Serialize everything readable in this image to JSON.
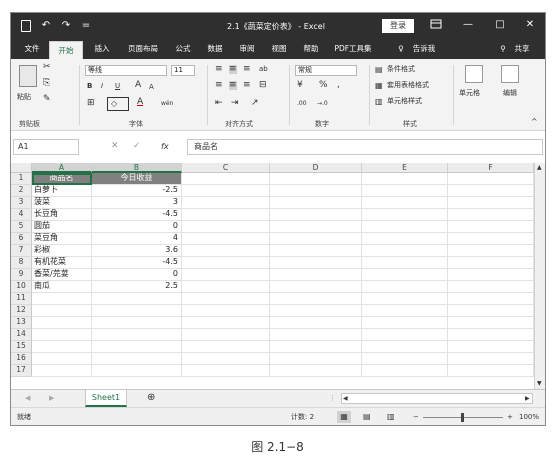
{
  "window": {
    "title": "2.1《蔬菜定价表》 - Excel",
    "login_label": "登录",
    "minimize": "—",
    "restore": "□",
    "close": "✕"
  },
  "qat": {
    "undo": "↶",
    "redo": "↷",
    "more": "="
  },
  "menu": {
    "items": [
      "文件",
      "开始",
      "插入",
      "页面布局",
      "公式",
      "数据",
      "审阅",
      "视图",
      "帮助",
      "PDF工具集"
    ],
    "tellme": "告诉我",
    "share": "共享",
    "active_index": 1
  },
  "ribbon": {
    "paste_label": "粘贴",
    "font_name": "等线",
    "font_size": "11",
    "bold": "B",
    "italic": "I",
    "underline": "U",
    "grow_font": "A",
    "shrink_font": "A",
    "wen": "wén",
    "number_format": "常规",
    "percent": "%",
    "comma": ",",
    "inc_decimal": ".00",
    "dec_decimal": "→.0",
    "cond_format": "条件格式",
    "table_format": "套用表格格式",
    "cell_styles": "单元格样式",
    "cells_label": "单元格",
    "edit_label": "编辑",
    "groups": [
      "剪贴板",
      "字体",
      "对齐方式",
      "数字",
      "样式"
    ]
  },
  "formula_bar": {
    "name_box": "A1",
    "fx": "fx",
    "cancel": "✕",
    "confirm": "✓",
    "content": "商品名"
  },
  "columns": [
    "A",
    "B",
    "C",
    "D",
    "E",
    "F"
  ],
  "rows": [
    "1",
    "2",
    "3",
    "4",
    "5",
    "6",
    "7",
    "8",
    "9",
    "10",
    "11",
    "12",
    "13",
    "14",
    "15",
    "16",
    "17"
  ],
  "table": {
    "headers": [
      "商品名",
      "今日收益"
    ],
    "rows": [
      [
        "白萝卜",
        "-2.5"
      ],
      [
        "菠菜",
        "3"
      ],
      [
        "长豆角",
        "-4.5"
      ],
      [
        "圆茄",
        "0"
      ],
      [
        "菜豆角",
        "4"
      ],
      [
        "彩椒",
        "3.6"
      ],
      [
        "有机花菜",
        "-4.5"
      ],
      [
        "香菜/芫荽",
        "0"
      ],
      [
        "南瓜",
        "2.5"
      ]
    ]
  },
  "sheet": {
    "tab": "Sheet1",
    "add": "⊕"
  },
  "status": {
    "ready": "就绪",
    "count": "计数: 2",
    "zoom": "100%",
    "minus": "−",
    "plus": "+"
  },
  "caption": "图 2.1−8"
}
